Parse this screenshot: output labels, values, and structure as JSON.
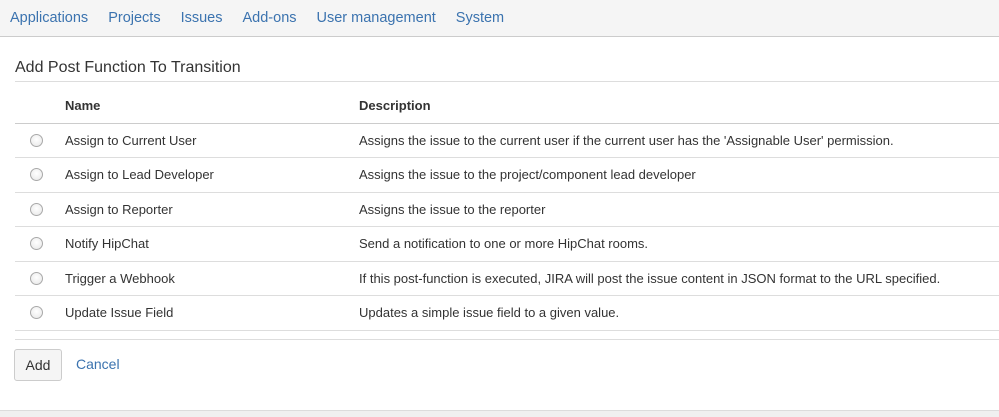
{
  "nav": {
    "items": [
      "Applications",
      "Projects",
      "Issues",
      "Add-ons",
      "User management",
      "System"
    ]
  },
  "page": {
    "title": "Add Post Function To Transition"
  },
  "table": {
    "headers": {
      "name": "Name",
      "description": "Description"
    },
    "rows": [
      {
        "name": "Assign to Current User",
        "description": "Assigns the issue to the current user if the current user has the 'Assignable User' permission."
      },
      {
        "name": "Assign to Lead Developer",
        "description": "Assigns the issue to the project/component lead developer"
      },
      {
        "name": "Assign to Reporter",
        "description": "Assigns the issue to the reporter"
      },
      {
        "name": "Notify HipChat",
        "description": "Send a notification to one or more HipChat rooms."
      },
      {
        "name": "Trigger a Webhook",
        "description": "If this post-function is executed, JIRA will post the issue content in JSON format to the URL specified."
      },
      {
        "name": "Update Issue Field",
        "description": "Updates a simple issue field to a given value."
      }
    ]
  },
  "actions": {
    "add_label": "Add",
    "cancel_label": "Cancel"
  },
  "colors": {
    "link": "#3b73af",
    "text": "#333333",
    "nav_background": "#f5f5f5"
  }
}
